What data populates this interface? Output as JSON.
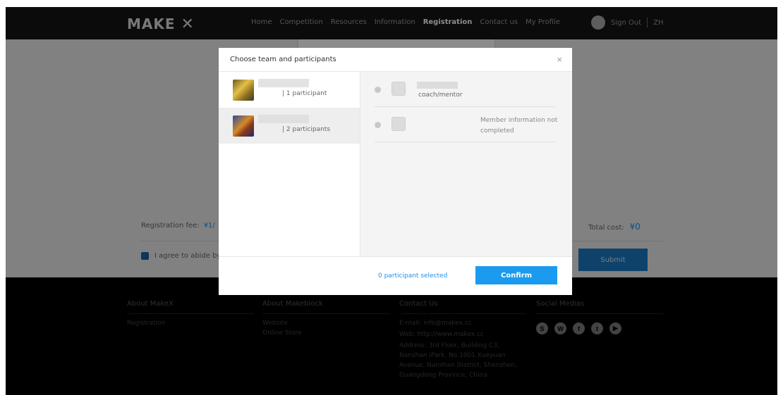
{
  "header": {
    "logo": "MAKE",
    "nav": [
      "Home",
      "Competition",
      "Resources",
      "Information",
      "Registration",
      "Contact us",
      "My Profile"
    ],
    "active_nav": "Registration",
    "sign_out": "Sign Out",
    "lang": "ZH"
  },
  "page": {
    "fee_label": "Registration fee:",
    "fee_amount": "¥1/",
    "total_label": "Total cost:",
    "total_amount": "¥0",
    "agree_text": "I agree to abide by",
    "submit_label": "Submit"
  },
  "footer": {
    "about_makex": {
      "head": "About MakeX",
      "items": [
        "Registration"
      ]
    },
    "about_makeblock": {
      "head": "About Makeblock",
      "items": [
        "Website",
        "Online Store"
      ]
    },
    "contact": {
      "head": "Contact Us",
      "email": "E-mail: info@makex.cc",
      "web": "Web: http://www.makex.cc",
      "address": "Address: 3rd Floor, Building C3, Nanshan iPark, No.1001 Xueyuan Avenue, Nanshan District, Shenzhen, Guangdong Province, China"
    },
    "social": {
      "head": "Social Medias",
      "icons": [
        "S",
        "W",
        "f",
        "t",
        "▶"
      ]
    }
  },
  "modal": {
    "title": "Choose team and participants",
    "close": "×",
    "teams": [
      {
        "count": "| 1 participant",
        "selected": false
      },
      {
        "count": "| 2 participants",
        "selected": true
      }
    ],
    "members": [
      {
        "role": "coach/mentor",
        "warning": ""
      },
      {
        "role": "",
        "warning": "Member information not completed"
      }
    ],
    "selected_count": "0 participant selected",
    "confirm_label": "Confirm"
  },
  "colors": {
    "accent": "#1a9bf0",
    "header_bg": "#141414",
    "footer_bg": "#000000"
  }
}
